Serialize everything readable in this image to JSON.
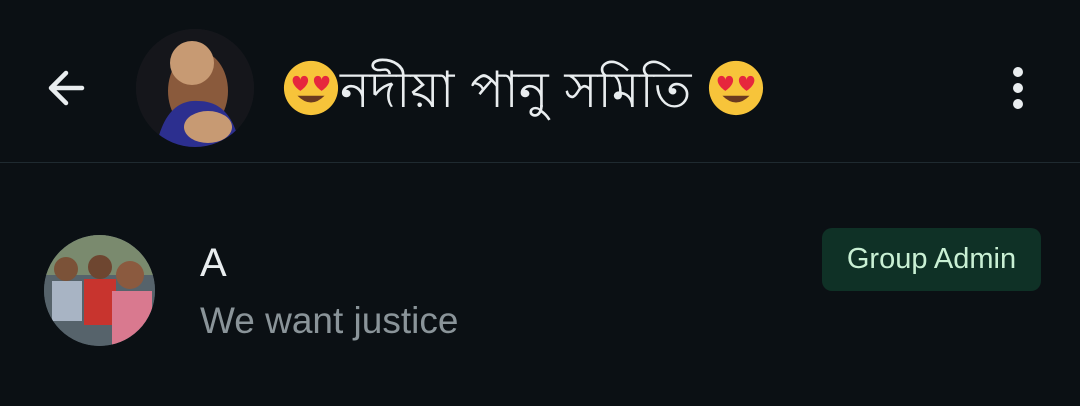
{
  "header": {
    "title": "নদীয়া পানু সমিতি",
    "title_emoji_left": "heart-eyes-emoji",
    "title_emoji_right": "heart-eyes-emoji",
    "back_icon": "arrow-left-icon",
    "menu_icon": "more-vertical-icon",
    "avatar": "group-avatar"
  },
  "member": {
    "name": "A",
    "status": "We want justice",
    "badge": "Group Admin",
    "avatar": "member-avatar"
  },
  "colors": {
    "background": "#0b1014",
    "primary_text": "#e9edef",
    "secondary_text": "#8a9499",
    "badge_bg": "#0f3126",
    "badge_text": "#c9f0d4"
  }
}
